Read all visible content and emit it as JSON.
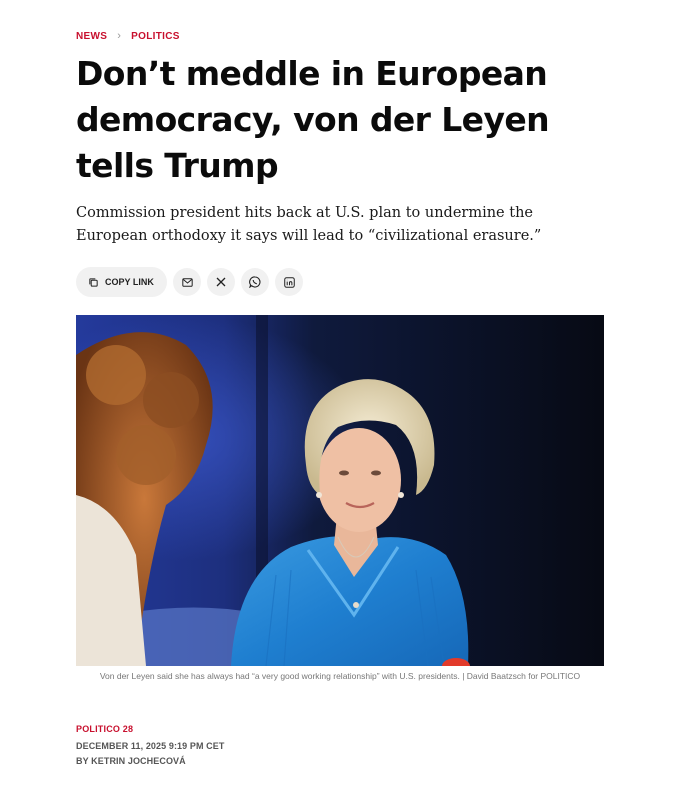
{
  "breadcrumb": {
    "items": [
      "NEWS",
      "POLITICS"
    ],
    "separator": "›"
  },
  "article": {
    "headline": "Don’t meddle in European democracy, von der Leyen tells Trump",
    "dek": "Commission president hits back at U.S. plan to undermine the European orthodoxy it says will lead to “civilizational erasure.”",
    "share": {
      "copy_link_label": "COPY LINK",
      "buttons": [
        "mail-icon",
        "x-icon",
        "whatsapp-icon",
        "linkedin-icon"
      ]
    },
    "image": {
      "caption": "Von der Leyen said she has always had “a very good working relationship” with U.S. presidents. | David Baatzsch for POLITICO"
    },
    "meta": {
      "source": "POLITICO 28",
      "date": "DECEMBER 11, 2025 9:19 PM CET",
      "byline": "BY KETRIN JOCHECOVÁ"
    }
  },
  "colors": {
    "accent": "#c8102e",
    "headline": "#0b0b0b",
    "muted": "#777777",
    "button_bg": "#f1f1f1"
  }
}
